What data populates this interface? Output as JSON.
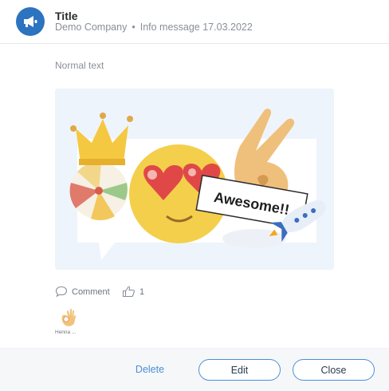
{
  "header": {
    "avatar_icon": "megaphone-icon",
    "title": "Title",
    "company": "Demo Company",
    "separator": "•",
    "subtitle": "Info message 17.03.2022"
  },
  "message": {
    "text": "Normal text",
    "image": {
      "description_icon": "emoji-illustration",
      "bubble_text": "Awesome!!"
    }
  },
  "actions": {
    "comment_icon": "comment-icon",
    "comment_label": "Comment",
    "like_icon": "thumbs-up-icon",
    "like_count": "1"
  },
  "reactions": [
    {
      "icon": "ok-hand-icon",
      "name": "Henna ..."
    }
  ],
  "footer": {
    "delete_label": "Delete",
    "edit_label": "Edit",
    "close_label": "Close"
  },
  "colors": {
    "accent": "#4a8fd6",
    "avatar_bg": "#2c73c0"
  }
}
